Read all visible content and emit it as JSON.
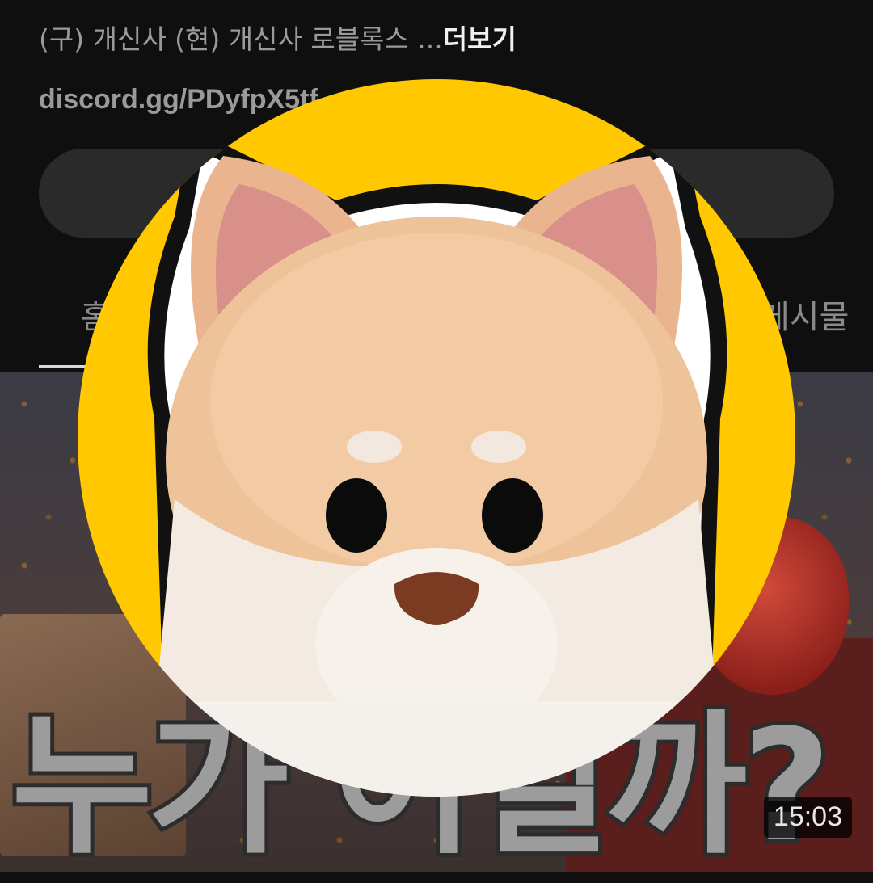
{
  "description": {
    "text": "(구) 개신사 (현) 개신사 로블록스 ...",
    "more_label": "더보기"
  },
  "link": "discord.gg/PDyfpX5tf",
  "tabs": [
    {
      "label": "홈"
    },
    {
      "label": "게시물"
    }
  ],
  "video": {
    "title": "누가 어걸까?",
    "duration": "15:03"
  },
  "colors": {
    "avatar_background": "#FFC800",
    "background": "#0F0F0F"
  }
}
